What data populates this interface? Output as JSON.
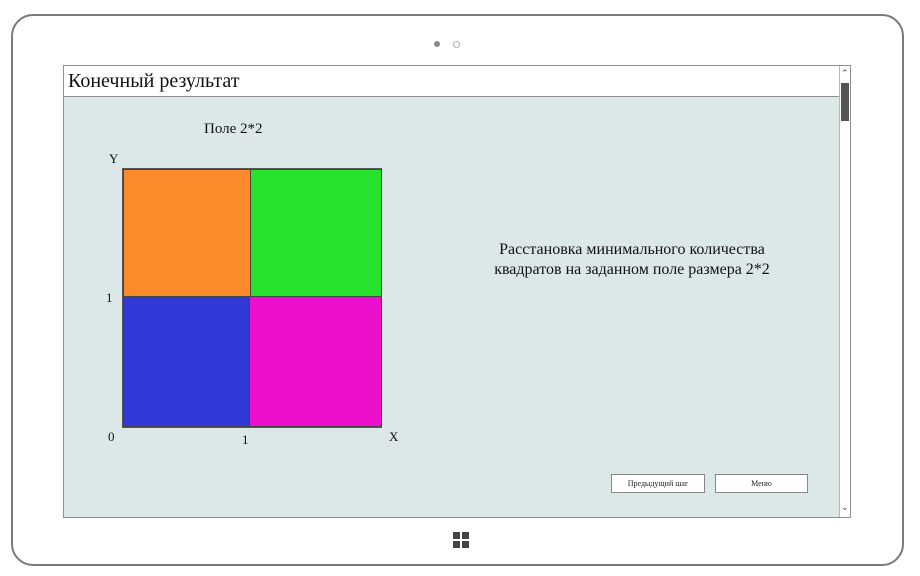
{
  "window": {
    "title": "Конечный результат"
  },
  "field": {
    "title": "Поле 2*2",
    "axis": {
      "y_label": "Y",
      "x_label": "X",
      "origin": "0",
      "y_tick": "1",
      "x_tick": "1"
    },
    "squares": [
      {
        "name": "top-left",
        "color": "#fb8a2a"
      },
      {
        "name": "top-right",
        "color": "#26e22c"
      },
      {
        "name": "bottom-left",
        "color": "#3038d6"
      },
      {
        "name": "bottom-right",
        "color": "#ec0fcc"
      }
    ]
  },
  "description": "Расстановка минимального количества квадратов на заданном поле размера 2*2",
  "buttons": {
    "prev": "Предыдущий шаг",
    "menu": "Меню"
  },
  "icons": {
    "scroll_up": "chevron-up-icon",
    "scroll_down": "chevron-down-icon",
    "windows": "windows-logo-icon"
  }
}
